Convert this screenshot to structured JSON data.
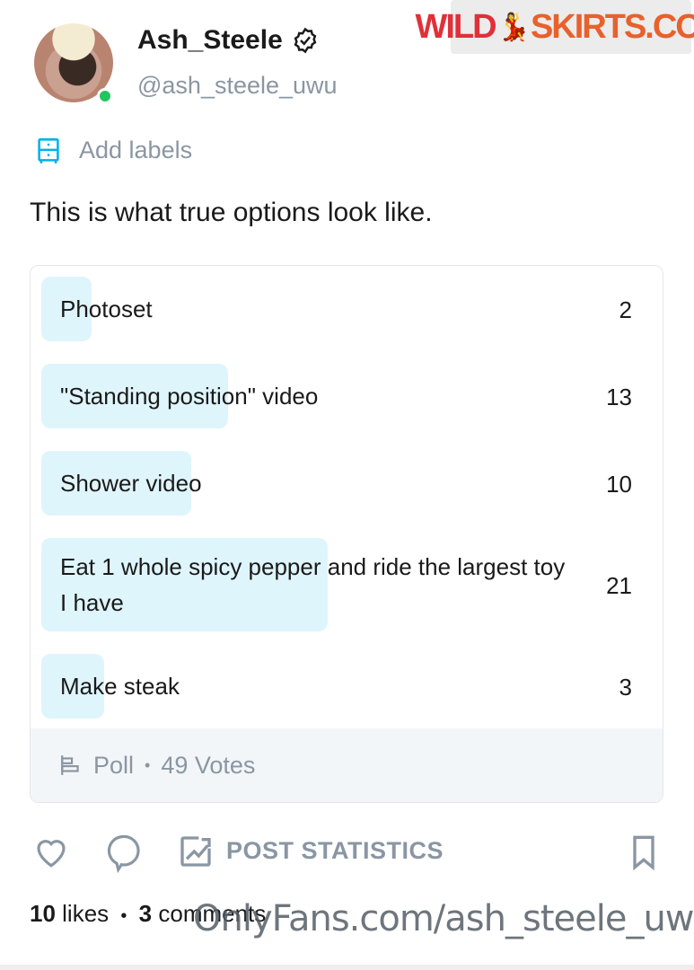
{
  "author": {
    "name": "Ash_Steele",
    "handle": "@ash_steele_uwu",
    "verified": true,
    "online": true
  },
  "labels_action": "Add labels",
  "post_text": "This is what true options look like.",
  "site_logo": {
    "part1": "WILD",
    "part2": "SKIRTS.COM"
  },
  "poll": {
    "options": [
      {
        "label": "Photoset",
        "votes": "2"
      },
      {
        "label": "\"Standing position\" video",
        "votes": "13"
      },
      {
        "label": "Shower video",
        "votes": "10"
      },
      {
        "label": "Eat 1 whole spicy pepper and ride the largest toy I have",
        "votes": "21"
      },
      {
        "label": "Make steak",
        "votes": "3"
      }
    ],
    "type_label": "Poll",
    "separator": "•",
    "votes_total": "49 Votes"
  },
  "actions": {
    "post_statistics": "POST STATISTICS"
  },
  "meta": {
    "likes": "10",
    "likes_label": "likes",
    "separator": "•",
    "comments": "3",
    "comments_label": "comments"
  },
  "watermark": "OnlyFans.com/ash_steele_uwu",
  "colors": {
    "poll_bar": "#dff5fc",
    "accent_icon": "#00aff0",
    "muted": "#8a96a3",
    "online": "#22c55e"
  }
}
